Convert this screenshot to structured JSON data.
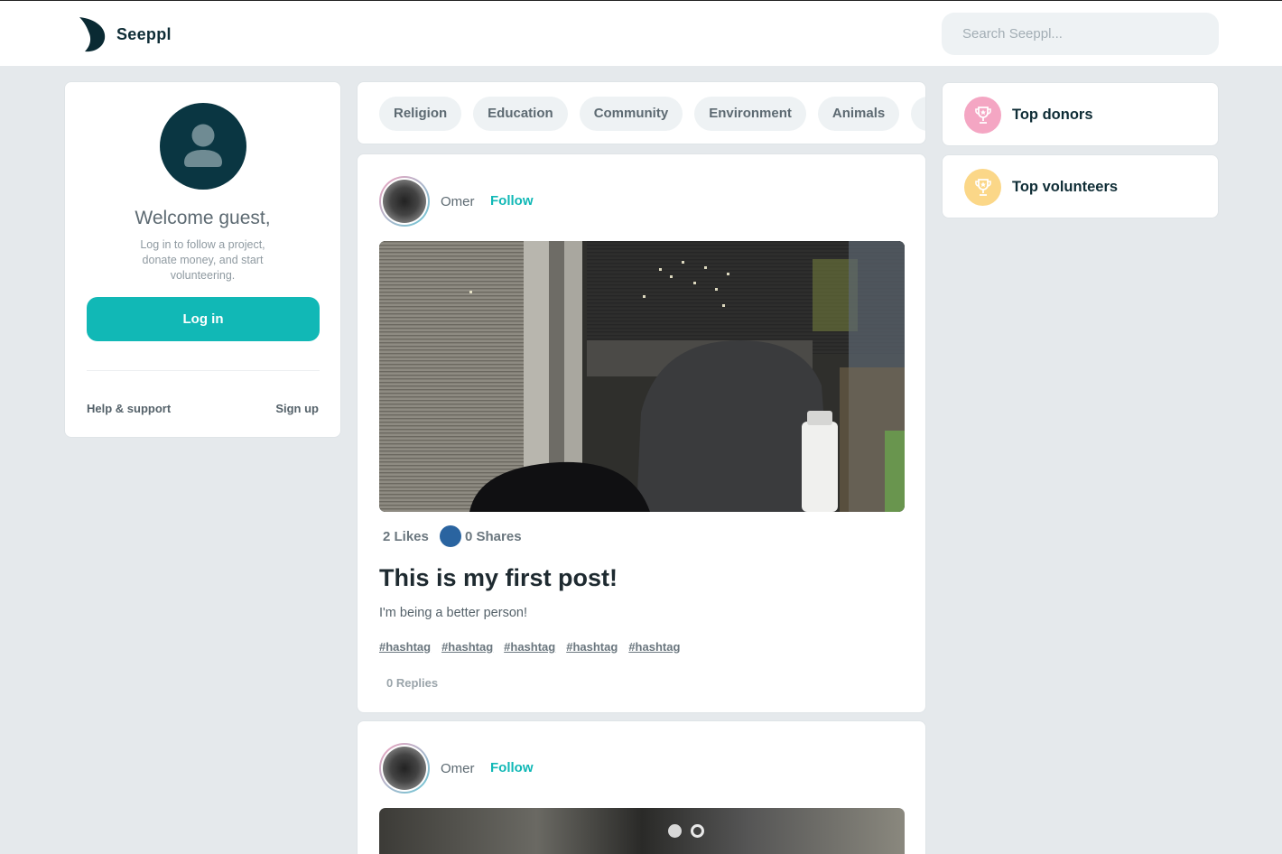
{
  "header": {
    "brand": "Seeppl",
    "search_placeholder": "Search Seeppl..."
  },
  "guest_card": {
    "welcome": "Welcome guest,",
    "description": "Log in to follow a project, donate money, and start volunteering.",
    "login_label": "Log in",
    "help_label": "Help & support",
    "signup_label": "Sign up"
  },
  "categories": [
    "Religion",
    "Education",
    "Community",
    "Environment",
    "Animals",
    "C"
  ],
  "posts": [
    {
      "author": "Omer",
      "follow_label": "Follow",
      "likes": "2 Likes",
      "shares": "0 Shares",
      "title": "This is my first post!",
      "body": "I'm being a better person!",
      "tags": [
        "#hashtag",
        "#hashtag",
        "#hashtag",
        "#hashtag",
        "#hashtag"
      ],
      "replies": "0 Replies"
    },
    {
      "author": "Omer",
      "follow_label": "Follow"
    }
  ],
  "sidebar_right": {
    "top_donors": "Top donors",
    "top_volunteers": "Top volunteers"
  },
  "colors": {
    "accent": "#11b8b6",
    "dark": "#0a3642",
    "donors_badge": "#f4a6c3",
    "volunteers_badge": "#fbd788",
    "share_badge": "#2a64a0"
  },
  "icons": {
    "logo": "crescent-logo-icon",
    "guest_avatar": "user-icon",
    "trophy": "trophy-icon"
  }
}
